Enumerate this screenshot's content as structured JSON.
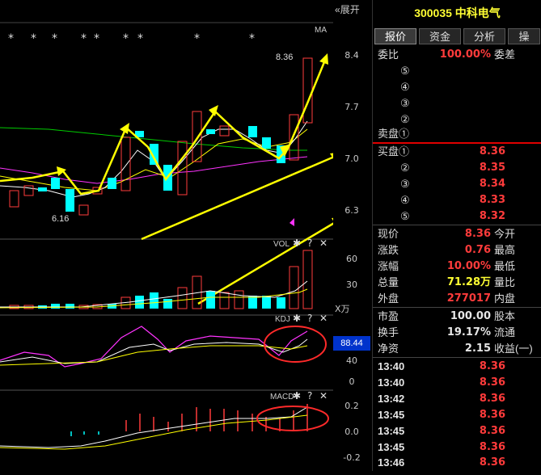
{
  "stock": {
    "code": "300035",
    "name": "中科电气"
  },
  "expand_label": "展开",
  "ma_label": "MA",
  "vol_panel_label": "VOL",
  "kdj_panel_label": "KDJ",
  "macd_panel_label": "MACD",
  "price_axis": [
    "8.4",
    "7.7",
    "7.0",
    "6.3"
  ],
  "vol_axis": [
    "60",
    "30",
    "X万"
  ],
  "kdj_axis": [
    "40",
    "0"
  ],
  "kdj_value": "88.44",
  "macd_axis": [
    "0.2",
    "0.0",
    "-0.2"
  ],
  "annotations": {
    "high": "8.36",
    "low": "6.16"
  },
  "tabs": [
    "报价",
    "资金",
    "分析",
    "操"
  ],
  "order_book": {
    "weibi_label": "委比",
    "weibi_value": "100.00%",
    "weicha_label": "委差",
    "sell_levels": [
      "⑤",
      "④",
      "③",
      "②",
      "卖盘①"
    ],
    "buy_levels": [
      {
        "label": "买盘①",
        "price": "8.36"
      },
      {
        "label": "②",
        "price": "8.35"
      },
      {
        "label": "③",
        "price": "8.34"
      },
      {
        "label": "④",
        "price": "8.33"
      },
      {
        "label": "⑤",
        "price": "8.32"
      }
    ]
  },
  "quote": [
    {
      "l": "现价",
      "v": "8.36",
      "r": "今开",
      "c": "red"
    },
    {
      "l": "涨跌",
      "v": "0.76",
      "r": "最高",
      "c": "red"
    },
    {
      "l": "涨幅",
      "v": "10.00%",
      "r": "最低",
      "c": "red"
    },
    {
      "l": "总量",
      "v": "71.28万",
      "r": "量比",
      "c": "yel"
    },
    {
      "l": "外盘",
      "v": "277017",
      "r": "内盘",
      "c": "red"
    }
  ],
  "fundamentals": [
    {
      "l": "市盈",
      "v": "100.00",
      "r": "股本"
    },
    {
      "l": "换手",
      "v": "19.17%",
      "r": "流通"
    },
    {
      "l": "净资",
      "v": "2.15",
      "r": "收益(一)"
    }
  ],
  "ticks": [
    {
      "t": "13:40",
      "p": "8.36"
    },
    {
      "t": "13:40",
      "p": "8.36"
    },
    {
      "t": "13:42",
      "p": "8.36"
    },
    {
      "t": "13:45",
      "p": "8.36"
    },
    {
      "t": "13:45",
      "p": "8.36"
    },
    {
      "t": "13:45",
      "p": "8.36"
    },
    {
      "t": "13:46",
      "p": "8.36"
    }
  ],
  "colors": {
    "up": "#ff3b3b",
    "down": "#00ffff",
    "ma5": "#ffffff",
    "ma10": "#ffff00",
    "ma20": "#ff33ff",
    "ma60": "#00cc00",
    "annot": "#ffff00",
    "circle": "#ff2a2a"
  }
}
